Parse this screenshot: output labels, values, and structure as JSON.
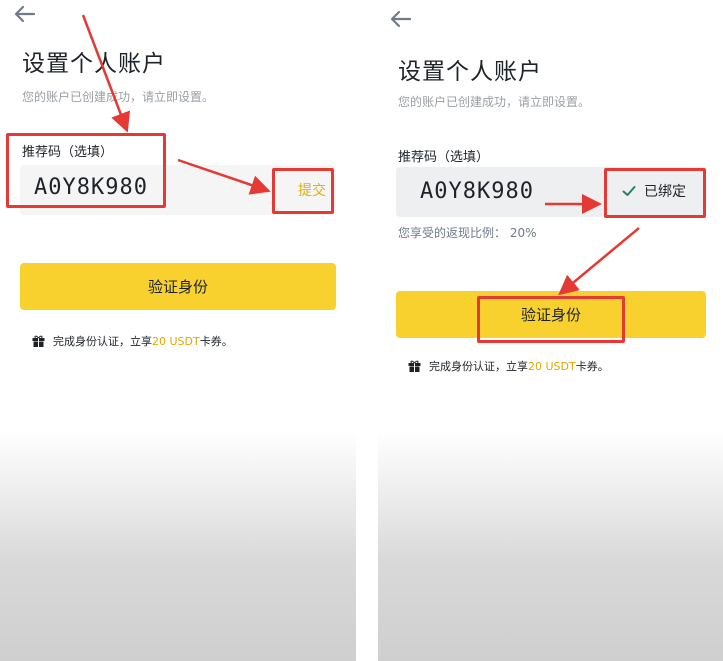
{
  "left_screen": {
    "title": "设置个人账户",
    "subtitle": "您的账户已创建成功，请立即设置。",
    "referral_label": "推荐码（选填）",
    "referral_code": "A0Y8K980",
    "submit_label": "提交",
    "verify_button": "验证身份",
    "promo_prefix": "完成身份认证，立享",
    "promo_highlight": "20 USDT",
    "promo_suffix": "卡券。",
    "icons": [
      "back-arrow-icon",
      "gift-icon"
    ]
  },
  "right_screen": {
    "title": "设置个人账户",
    "subtitle": "您的账户已创建成功，请立即设置。",
    "referral_label": "推荐码（选填）",
    "referral_code": "A0Y8K980",
    "bound_label": "已绑定",
    "ratio_label": "您享受的返现比例：",
    "ratio_value": "20%",
    "verify_button": "验证身份",
    "promo_prefix": "完成身份认证，立享",
    "promo_highlight": "20 USDT",
    "promo_suffix": "卡券。",
    "icons": [
      "back-arrow-icon",
      "check-icon",
      "gift-icon"
    ]
  },
  "colors": {
    "accent_yellow": "#f8d12f",
    "annotation_red": "#e53935",
    "text_dark": "#1e2329",
    "text_muted": "#9aa0a6"
  }
}
